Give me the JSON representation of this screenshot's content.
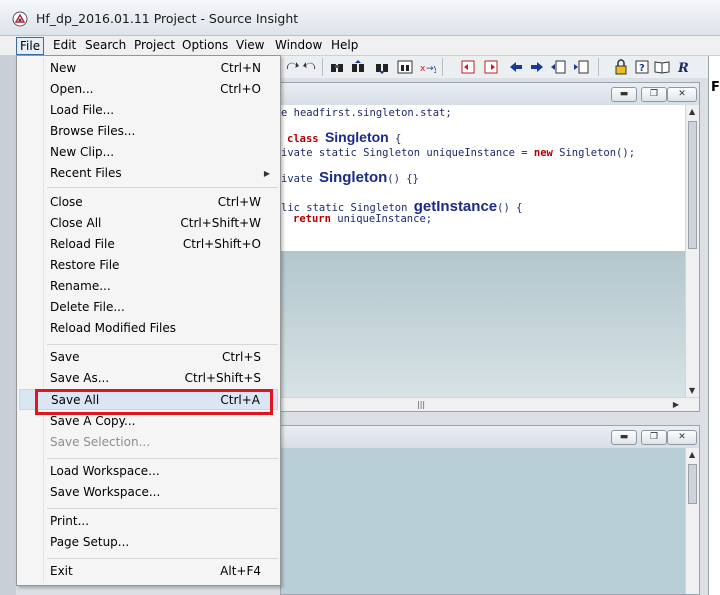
{
  "window": {
    "title": "Hf_dp_2016.01.11 Project - Source Insight"
  },
  "menubar": [
    "File",
    "Edit",
    "Search",
    "Project",
    "Options",
    "View",
    "Window",
    "Help"
  ],
  "file_menu": {
    "items": [
      {
        "label": "New",
        "accel": "Ctrl+N"
      },
      {
        "label": "Open...",
        "accel": "Ctrl+O"
      },
      {
        "label": "Load File...",
        "accel": ""
      },
      {
        "label": "Browse Files...",
        "accel": ""
      },
      {
        "label": "New Clip...",
        "accel": ""
      },
      {
        "label": "Recent Files",
        "accel": "",
        "submenu": true
      },
      {
        "label": "Close",
        "accel": "Ctrl+W"
      },
      {
        "label": "Close All",
        "accel": "Ctrl+Shift+W"
      },
      {
        "label": "Reload File",
        "accel": "Ctrl+Shift+O"
      },
      {
        "label": "Restore File",
        "accel": ""
      },
      {
        "label": "Rename...",
        "accel": ""
      },
      {
        "label": "Delete File...",
        "accel": ""
      },
      {
        "label": "Reload Modified Files",
        "accel": ""
      },
      {
        "label": "Save",
        "accel": "Ctrl+S"
      },
      {
        "label": "Save As...",
        "accel": "Ctrl+Shift+S"
      },
      {
        "label": "Save All",
        "accel": "Ctrl+A",
        "highlighted": true
      },
      {
        "label": "Save A Copy...",
        "accel": ""
      },
      {
        "label": "Save Selection...",
        "accel": "",
        "disabled": true
      },
      {
        "label": "Load Workspace...",
        "accel": ""
      },
      {
        "label": "Save Workspace...",
        "accel": ""
      },
      {
        "label": "Print...",
        "accel": ""
      },
      {
        "label": "Page Setup...",
        "accel": ""
      },
      {
        "label": "Exit",
        "accel": "Alt+F4"
      }
    ]
  },
  "code": {
    "line1": "e headfirst.singleton.stat;",
    "line2_kw": "class",
    "line2_name": "Singleton",
    "line2_rest": " {",
    "line3": "ivate static Singleton uniqueInstance = ",
    "line3_kw": "new",
    "line3_rest": " Singleton();",
    "line4_pre": "ivate ",
    "line4_name": "Singleton",
    "line4_rest": "() {}",
    "line5_pre": "lic static Singleton ",
    "line5_name": "getInstance",
    "line5_rest": "() {",
    "line6_kw": "return",
    "line6_rest": " uniqueInstance;"
  },
  "right_pane": {
    "letter": "F"
  },
  "colors": {
    "highlight_box": "#e0161e",
    "menu_hover": "#dbe6f4"
  }
}
